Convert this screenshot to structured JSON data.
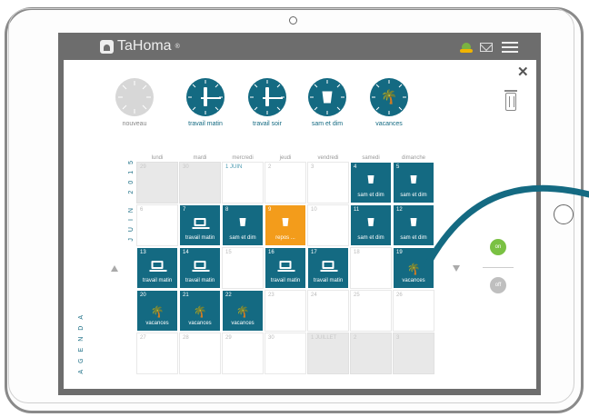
{
  "app": {
    "brand": "TaHoma",
    "brand_mark": "®"
  },
  "header": {
    "icons": [
      "user-icon",
      "mail-icon",
      "menu-icon"
    ]
  },
  "panel": {
    "templates": [
      {
        "label": "nouveau",
        "icon": "blank"
      },
      {
        "label": "travail matin",
        "icon": "laptop"
      },
      {
        "label": "travail soir",
        "icon": "laptop"
      },
      {
        "label": "sam et dim",
        "icon": "cup"
      },
      {
        "label": "vacances",
        "icon": "palm"
      }
    ],
    "days": [
      "lundi",
      "mardi",
      "mercredi",
      "jeudi",
      "vendredi",
      "samedi",
      "dimanche"
    ],
    "month_label": "JUIN",
    "year_label": "2015",
    "side_label": "AGENDA",
    "toggle_on": "on",
    "toggle_off": "off"
  },
  "calendar": [
    [
      {
        "n": "29",
        "s": "grey"
      },
      {
        "n": "30",
        "s": "grey"
      },
      {
        "n": "1 JUIN",
        "s": "white",
        "first": true
      },
      {
        "n": "2",
        "s": "white"
      },
      {
        "n": "3",
        "s": "white"
      },
      {
        "n": "4",
        "s": "teal",
        "icon": "cup",
        "label": "sam et dim"
      },
      {
        "n": "5",
        "s": "teal",
        "icon": "cup",
        "label": "sam et dim"
      }
    ],
    [
      {
        "n": "6",
        "s": "white"
      },
      {
        "n": "7",
        "s": "teal",
        "icon": "laptop",
        "label": "travail matin"
      },
      {
        "n": "8",
        "s": "teal",
        "icon": "cup",
        "label": "sam et dim"
      },
      {
        "n": "9",
        "s": "orange",
        "icon": "cup",
        "label": "repos ..."
      },
      {
        "n": "10",
        "s": "white"
      },
      {
        "n": "11",
        "s": "teal",
        "icon": "cup",
        "label": "sam et dim"
      },
      {
        "n": "12",
        "s": "teal",
        "icon": "cup",
        "label": "sam et dim"
      }
    ],
    [
      {
        "n": "13",
        "s": "teal",
        "icon": "laptop",
        "label": "travail matin"
      },
      {
        "n": "14",
        "s": "teal",
        "icon": "laptop",
        "label": "travail matin"
      },
      {
        "n": "15",
        "s": "white"
      },
      {
        "n": "16",
        "s": "teal",
        "icon": "laptop",
        "label": "travail matin"
      },
      {
        "n": "17",
        "s": "teal",
        "icon": "laptop",
        "label": "travail matin"
      },
      {
        "n": "18",
        "s": "white"
      },
      {
        "n": "19",
        "s": "teal",
        "icon": "palm",
        "label": "vacances"
      }
    ],
    [
      {
        "n": "20",
        "s": "teal",
        "icon": "palm",
        "label": "vacances"
      },
      {
        "n": "21",
        "s": "teal",
        "icon": "palm",
        "label": "vacances"
      },
      {
        "n": "22",
        "s": "teal",
        "icon": "palm",
        "label": "vacances"
      },
      {
        "n": "23",
        "s": "white"
      },
      {
        "n": "24",
        "s": "white"
      },
      {
        "n": "25",
        "s": "white"
      },
      {
        "n": "26",
        "s": "white"
      }
    ],
    [
      {
        "n": "27",
        "s": "white"
      },
      {
        "n": "28",
        "s": "white"
      },
      {
        "n": "29",
        "s": "white"
      },
      {
        "n": "30",
        "s": "white"
      },
      {
        "n": "1 JUILLET",
        "s": "grey"
      },
      {
        "n": "2",
        "s": "grey"
      },
      {
        "n": "3",
        "s": "grey"
      }
    ]
  ],
  "colors": {
    "teal": "#146a82",
    "orange": "#f39c1b",
    "green": "#7ac143",
    "grey": "#e8e8e8"
  }
}
